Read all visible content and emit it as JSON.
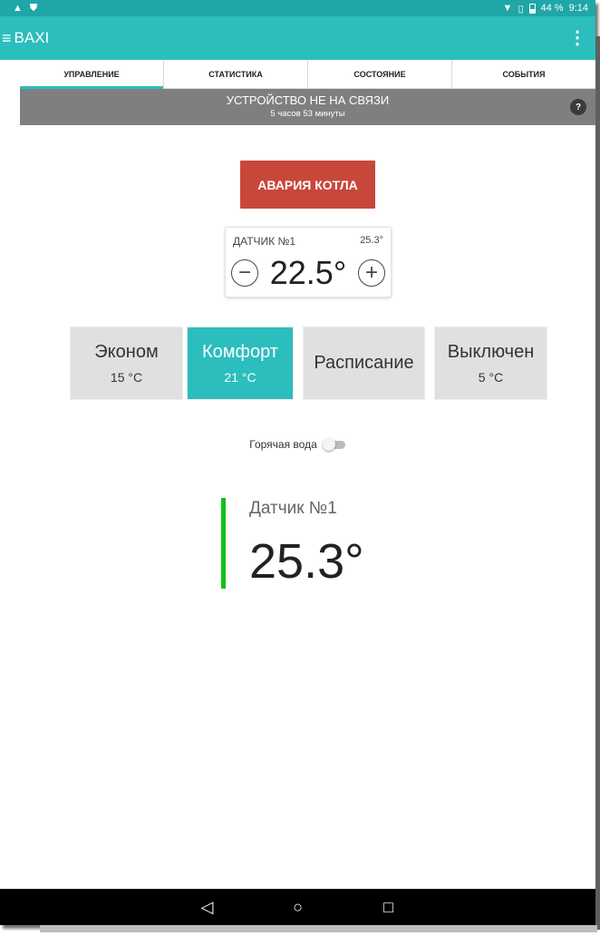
{
  "status_bar": {
    "left_icons": [
      "warning-icon",
      "shield-icon"
    ],
    "right_icons": [
      "wifi-icon",
      "sim-icon",
      "battery-icon"
    ],
    "battery": "44 %",
    "time": "9:14"
  },
  "app_bar": {
    "title": "BAXI",
    "menu_icon": "menu-icon",
    "more_icon": "more-vert-icon"
  },
  "tabs": [
    {
      "label": "УПРАВЛЕНИЕ",
      "active": true
    },
    {
      "label": "СТАТИСТИКА",
      "active": false
    },
    {
      "label": "СОСТОЯНИЕ",
      "active": false
    },
    {
      "label": "СОБЫТИЯ",
      "active": false
    }
  ],
  "banner": {
    "title": "УСТРОЙСТВО НЕ НА СВЯЗИ",
    "subtitle": "5 часов 53 минуты",
    "help": "?"
  },
  "alarm": {
    "label": "АВАРИЯ КОТЛА"
  },
  "sensor_card": {
    "label": "ДАТЧИК №1",
    "current": "25.3°",
    "setpoint": "22.5°",
    "minus": "−",
    "plus": "+"
  },
  "modes": [
    {
      "name": "Эконом",
      "temp": "15 °C",
      "active": false
    },
    {
      "name": "Комфорт",
      "temp": "21 °C",
      "active": true
    },
    {
      "name": "Расписание",
      "temp": "",
      "active": false
    },
    {
      "name": "Выключен",
      "temp": "5 °C",
      "active": false
    }
  ],
  "hot_water": {
    "label": "Горячая вода",
    "enabled": false
  },
  "reading": {
    "label": "Датчик №1",
    "value": "25.3°"
  },
  "nav_bar": {
    "back": "◁",
    "home": "○",
    "recents": "□"
  },
  "colors": {
    "accent": "#2cbdbd",
    "status_bar": "#1fa6a6",
    "alarm": "#c8473b",
    "banner": "#7f7f7f",
    "sensor_indicator": "#11c11a"
  }
}
